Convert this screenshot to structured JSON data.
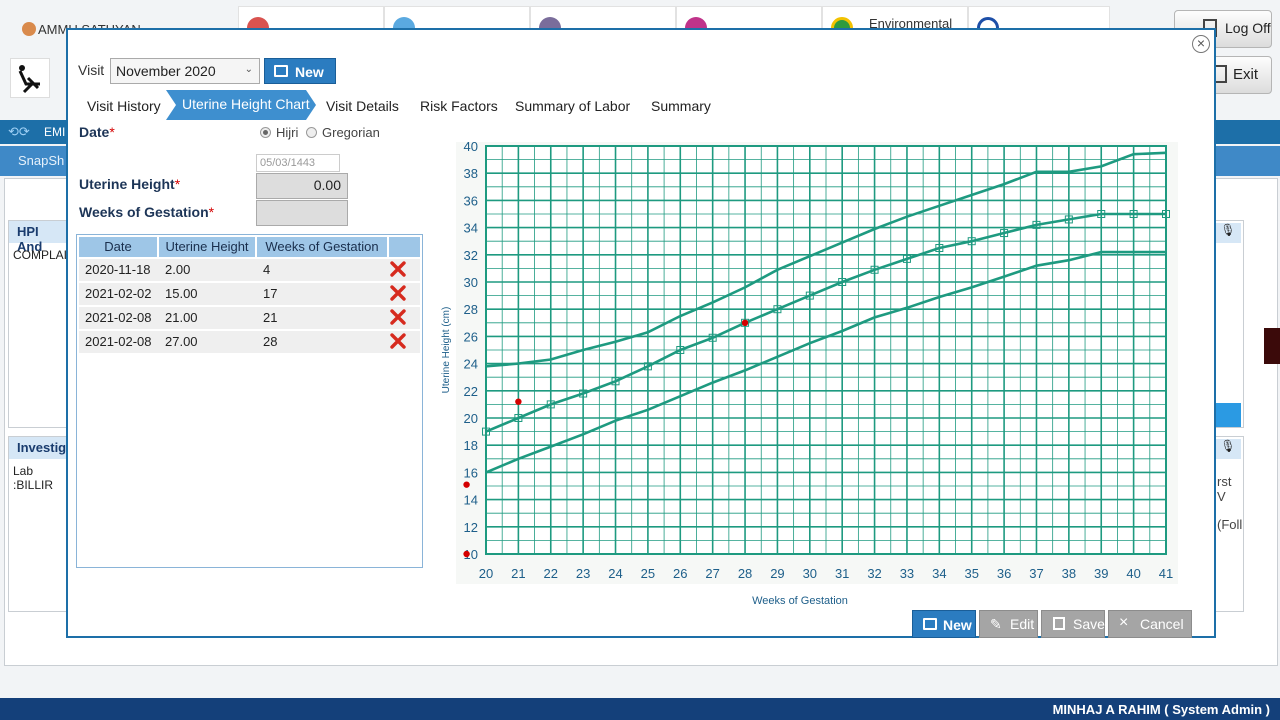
{
  "background": {
    "user_name": "AMMU SATHYAN",
    "top_tiles": [
      "",
      "",
      "",
      "",
      "Environmental",
      ""
    ],
    "logoff_label": "Log Off",
    "exit_label": "Exit",
    "emr_label": "EMI",
    "snapshot_label": "SnapSh",
    "hpi_title": "HPI And",
    "complaint_text": "COMPLAIN",
    "investigation_title": "Investig",
    "lab_text": "Lab :BILLIR",
    "right_text_1": "rst V",
    "right_text_2": "(Foll",
    "status_user": "MINHAJ A RAHIM  ( System Admin )"
  },
  "modal": {
    "visit_label": "Visit",
    "visit_value": "November 2020",
    "top_new_label": "New",
    "tabs": [
      {
        "label": "Visit History"
      },
      {
        "label": "Uterine Height Chart",
        "active": true
      },
      {
        "label": "Visit Details"
      },
      {
        "label": "Risk Factors"
      },
      {
        "label": "Summary of Labor"
      },
      {
        "label": "Summary"
      }
    ],
    "form": {
      "date_label": "Date",
      "required_mark": "*",
      "radio_hijri": "Hijri",
      "radio_gregorian": "Gregorian",
      "date_value": "05/03/1443",
      "uterine_height_label": "Uterine Height",
      "uterine_height_value": "0.00",
      "weeks_label": "Weeks of Gestation",
      "weeks_value": ""
    },
    "table": {
      "headers": [
        "Date",
        "Uterine Height",
        "Weeks of Gestation",
        ""
      ],
      "rows": [
        {
          "date": "2020-11-18",
          "height": "2.00",
          "weeks": "4"
        },
        {
          "date": "2021-02-02",
          "height": "15.00",
          "weeks": "17"
        },
        {
          "date": "2021-02-08",
          "height": "21.00",
          "weeks": "21"
        },
        {
          "date": "2021-02-08",
          "height": "27.00",
          "weeks": "28"
        }
      ]
    },
    "footer": {
      "new": "New",
      "edit": "Edit",
      "save": "Save",
      "cancel": "Cancel"
    }
  },
  "chart_data": {
    "type": "line",
    "xlabel": "Weeks of Gestation",
    "ylabel": "Uterine Height (cm)",
    "xlim": [
      20,
      41
    ],
    "ylim": [
      10,
      40
    ],
    "x_ticks": [
      20,
      21,
      22,
      23,
      24,
      25,
      26,
      27,
      28,
      29,
      30,
      31,
      32,
      33,
      34,
      35,
      36,
      37,
      38,
      39,
      40,
      41
    ],
    "y_ticks": [
      10,
      12,
      14,
      16,
      18,
      20,
      22,
      24,
      26,
      28,
      30,
      32,
      34,
      36,
      38,
      40
    ],
    "grid": true,
    "colors": {
      "grid": "#1e9a80",
      "curves": "#1e9a80",
      "points": "#d40000"
    },
    "series": [
      {
        "x": [
          20,
          21,
          22,
          23,
          24,
          25,
          26,
          27,
          28,
          29,
          30,
          31,
          32,
          33,
          34,
          35,
          36,
          37,
          38,
          39,
          40,
          41
        ],
        "values": [
          23.8,
          24.0,
          24.3,
          25.0,
          25.6,
          26.3,
          27.5,
          28.5,
          29.6,
          30.9,
          31.9,
          32.9,
          33.9,
          34.8,
          35.6,
          36.4,
          37.2,
          38.1,
          38.1,
          38.5,
          39.4,
          39.5
        ]
      },
      {
        "x": [
          20,
          21,
          22,
          23,
          24,
          25,
          26,
          27,
          28,
          29,
          30,
          31,
          32,
          33,
          34,
          35,
          36,
          37,
          38,
          39,
          40,
          41
        ],
        "values": [
          19.0,
          20.0,
          21.0,
          21.8,
          22.7,
          23.8,
          25.0,
          25.9,
          27.0,
          28.0,
          29.0,
          30.0,
          30.9,
          31.7,
          32.5,
          33.0,
          33.6,
          34.2,
          34.6,
          35.0,
          35.0,
          35.0
        ]
      },
      {
        "x": [
          20,
          21,
          22,
          23,
          24,
          25,
          26,
          27,
          28,
          29,
          30,
          31,
          32,
          33,
          34,
          35,
          36,
          37,
          38,
          39,
          40,
          41
        ],
        "values": [
          16.0,
          17.0,
          17.9,
          18.8,
          19.8,
          20.6,
          21.6,
          22.6,
          23.5,
          24.5,
          25.5,
          26.4,
          27.4,
          28.1,
          28.9,
          29.6,
          30.4,
          31.2,
          31.6,
          32.2,
          32.2,
          32.2
        ]
      }
    ],
    "points": [
      {
        "x": 21,
        "y": 21.2
      },
      {
        "x": 28,
        "y": 27.0
      },
      {
        "x": 19.4,
        "y": 15.1
      },
      {
        "x": 19.4,
        "y": 10.0
      }
    ]
  }
}
